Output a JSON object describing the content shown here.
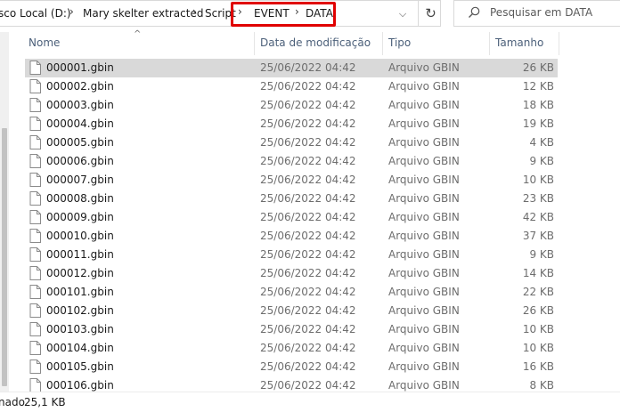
{
  "address": {
    "crumbs": [
      "sco Local (D:)",
      "Mary skelter extracted",
      "Script",
      "EVENT",
      "DATA"
    ]
  },
  "search": {
    "placeholder": "Pesquisar em DATA"
  },
  "columns": {
    "name": "Nome",
    "date": "Data de modificação",
    "type": "Tipo",
    "size": "Tamanho"
  },
  "files": [
    {
      "name": "000001.gbin",
      "date": "25/06/2022 04:42",
      "type": "Arquivo GBIN",
      "size": "26 KB"
    },
    {
      "name": "000002.gbin",
      "date": "25/06/2022 04:42",
      "type": "Arquivo GBIN",
      "size": "12 KB"
    },
    {
      "name": "000003.gbin",
      "date": "25/06/2022 04:42",
      "type": "Arquivo GBIN",
      "size": "18 KB"
    },
    {
      "name": "000004.gbin",
      "date": "25/06/2022 04:42",
      "type": "Arquivo GBIN",
      "size": "19 KB"
    },
    {
      "name": "000005.gbin",
      "date": "25/06/2022 04:42",
      "type": "Arquivo GBIN",
      "size": "4 KB"
    },
    {
      "name": "000006.gbin",
      "date": "25/06/2022 04:42",
      "type": "Arquivo GBIN",
      "size": "9 KB"
    },
    {
      "name": "000007.gbin",
      "date": "25/06/2022 04:42",
      "type": "Arquivo GBIN",
      "size": "10 KB"
    },
    {
      "name": "000008.gbin",
      "date": "25/06/2022 04:42",
      "type": "Arquivo GBIN",
      "size": "23 KB"
    },
    {
      "name": "000009.gbin",
      "date": "25/06/2022 04:42",
      "type": "Arquivo GBIN",
      "size": "42 KB"
    },
    {
      "name": "000010.gbin",
      "date": "25/06/2022 04:42",
      "type": "Arquivo GBIN",
      "size": "37 KB"
    },
    {
      "name": "000011.gbin",
      "date": "25/06/2022 04:42",
      "type": "Arquivo GBIN",
      "size": "9 KB"
    },
    {
      "name": "000012.gbin",
      "date": "25/06/2022 04:42",
      "type": "Arquivo GBIN",
      "size": "14 KB"
    },
    {
      "name": "000101.gbin",
      "date": "25/06/2022 04:42",
      "type": "Arquivo GBIN",
      "size": "22 KB"
    },
    {
      "name": "000102.gbin",
      "date": "25/06/2022 04:42",
      "type": "Arquivo GBIN",
      "size": "26 KB"
    },
    {
      "name": "000103.gbin",
      "date": "25/06/2022 04:42",
      "type": "Arquivo GBIN",
      "size": "10 KB"
    },
    {
      "name": "000104.gbin",
      "date": "25/06/2022 04:42",
      "type": "Arquivo GBIN",
      "size": "10 KB"
    },
    {
      "name": "000105.gbin",
      "date": "25/06/2022 04:42",
      "type": "Arquivo GBIN",
      "size": "16 KB"
    },
    {
      "name": "000106.gbin",
      "date": "25/06/2022 04:42",
      "type": "Arquivo GBIN",
      "size": "8 KB"
    }
  ],
  "selected_index": 0,
  "status": {
    "selection_text": "nado",
    "size": "25,1 KB"
  },
  "colors": {
    "highlight": "#e00000",
    "header_text": "#4c607a",
    "selected_row": "#d9d9d9"
  }
}
